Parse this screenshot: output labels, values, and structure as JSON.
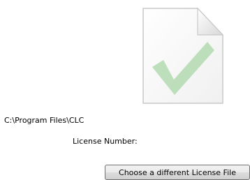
{
  "license": {
    "path": "C:\\Program Files\\CLC",
    "number_label": "License Number:",
    "choose_button_label": "Choose a different License File"
  },
  "icons": {
    "file": "document-checkmark-icon"
  }
}
